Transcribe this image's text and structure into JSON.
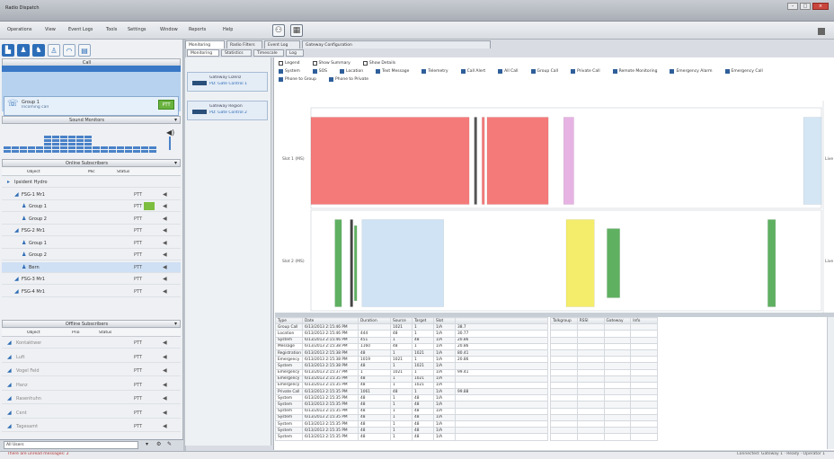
{
  "app": {
    "title": "Radio Dispatch"
  },
  "menu": {
    "items": [
      "Operations",
      "View",
      "Event Logs",
      "Tools",
      "Settings",
      "Window",
      "Reports",
      "Help"
    ]
  },
  "left": {
    "call_section": "Call",
    "call": {
      "title": "Group 1",
      "subtitle": "Incoming call",
      "ptt": "PTT"
    },
    "sound_section": "Sound Monitors",
    "meter_levels": [
      0.3,
      0.3,
      0.3,
      0.3,
      0.3,
      0.65,
      0.65,
      0.65,
      0.65,
      0.65,
      0.65,
      0.3,
      0.3,
      0.3,
      0.3,
      0.3,
      0.22,
      0.22,
      0.22
    ],
    "online_section": "Online Subscribers",
    "online_headers": [
      "Object",
      "Mic",
      "Status"
    ],
    "tree": [
      {
        "label": "Ipsident Hydro",
        "indent": 0,
        "ptt": "",
        "sel": false,
        "green": false
      },
      {
        "label": "FSG-1 Mr1",
        "indent": 1,
        "ptt": "PTT",
        "sel": false,
        "green": false
      },
      {
        "label": "Group 1",
        "indent": 2,
        "ptt": "PTT",
        "sel": false,
        "green": true
      },
      {
        "label": "Group 2",
        "indent": 2,
        "ptt": "PTT",
        "sel": false,
        "green": false
      },
      {
        "label": "FSG-2 Mr1",
        "indent": 1,
        "ptt": "PTT",
        "sel": false,
        "green": false
      },
      {
        "label": "Group 1",
        "indent": 2,
        "ptt": "PTT",
        "sel": false,
        "green": false
      },
      {
        "label": "Group 2",
        "indent": 2,
        "ptt": "PTT",
        "sel": false,
        "green": false
      },
      {
        "label": "Bern",
        "indent": 2,
        "ptt": "PTT",
        "sel": true,
        "green": false
      },
      {
        "label": "FSG-3 Mr1",
        "indent": 1,
        "ptt": "PTT",
        "sel": false,
        "green": false
      },
      {
        "label": "FSG-4 Mr1",
        "indent": 1,
        "ptt": "PTT",
        "sel": false,
        "green": false
      }
    ],
    "offline_section": "Offline Subscribers",
    "offline_headers": [
      "Object",
      "Prio",
      "Status"
    ],
    "offline": [
      {
        "label": "Kontaktwer",
        "ptt": "PTT"
      },
      {
        "label": "Luft",
        "ptt": "PTT"
      },
      {
        "label": "Vogel Feld",
        "ptt": "PTT"
      },
      {
        "label": "Hanz",
        "ptt": "PTT"
      },
      {
        "label": "Rasenhuhn",
        "ptt": "PTT"
      },
      {
        "label": "Cent",
        "ptt": "PTT"
      },
      {
        "label": "Tagesamt",
        "ptt": "PTT"
      }
    ],
    "bottom_select": "All Users"
  },
  "tabs": {
    "main": [
      "Monitoring",
      "Radio Filters",
      "Event Log",
      "Gateway Configuration"
    ],
    "sub": [
      "Monitoring",
      "Statistics",
      "Timescale",
      "Log"
    ]
  },
  "gateways": [
    {
      "name": "Gateway Lizenz",
      "status": "PD: Gate Control 1"
    },
    {
      "name": "Gateway Region",
      "status": "PD: Gate Control 2"
    }
  ],
  "legend": {
    "row1": [
      {
        "label": "Legend",
        "on": false
      },
      {
        "label": "Show Summary",
        "on": false
      },
      {
        "label": "Show Details",
        "on": false
      }
    ],
    "row2": [
      {
        "label": "System",
        "on": true
      },
      {
        "label": "SOS",
        "on": true
      },
      {
        "label": "Location",
        "on": true
      },
      {
        "label": "Text Message",
        "on": true
      },
      {
        "label": "Telemetry",
        "on": true
      },
      {
        "label": "Call Alert",
        "on": true
      },
      {
        "label": "All Call",
        "on": true
      },
      {
        "label": "Group Call",
        "on": true
      },
      {
        "label": "Private Call",
        "on": true
      },
      {
        "label": "Remote Monitoring",
        "on": true
      },
      {
        "label": "Emergency Alarm",
        "on": true
      },
      {
        "label": "Emergency Call",
        "on": true
      }
    ],
    "row3": [
      {
        "label": "Phone to Group",
        "on": true
      },
      {
        "label": "Phone to Private",
        "on": true
      }
    ]
  },
  "chart_data": {
    "type": "timeline",
    "rows": [
      "Slot 1 (MS)",
      "Slot 2 (MS)"
    ],
    "right_label": "Live",
    "bars": [
      {
        "row": 0,
        "start": 0.0,
        "end": 0.31,
        "color": "#f47a7a",
        "h": 0.92
      },
      {
        "row": 0,
        "start": 0.32,
        "end": 0.325,
        "color": "#555555",
        "h": 0.92
      },
      {
        "row": 0,
        "start": 0.335,
        "end": 0.34,
        "color": "#f47a7a",
        "h": 0.92
      },
      {
        "row": 0,
        "start": 0.345,
        "end": 0.465,
        "color": "#f47a7a",
        "h": 0.92
      },
      {
        "row": 0,
        "start": 0.495,
        "end": 0.515,
        "color": "#e6b3e3",
        "h": 0.92
      },
      {
        "row": 0,
        "start": 0.965,
        "end": 1.0,
        "color": "#d4e6f4",
        "h": 0.92
      },
      {
        "row": 1,
        "start": 0.047,
        "end": 0.06,
        "color": "#5fb061",
        "h": 0.92
      },
      {
        "row": 1,
        "start": 0.077,
        "end": 0.082,
        "color": "#444444",
        "h": 0.92
      },
      {
        "row": 1,
        "start": 0.085,
        "end": 0.09,
        "color": "#5fb061",
        "h": 0.8
      },
      {
        "row": 1,
        "start": 0.1,
        "end": 0.26,
        "color": "#cfe3f5",
        "h": 0.92
      },
      {
        "row": 1,
        "start": 0.5,
        "end": 0.555,
        "color": "#f4ec6b",
        "h": 0.92
      },
      {
        "row": 1,
        "start": 0.58,
        "end": 0.605,
        "color": "#5fb061",
        "h": 0.74
      },
      {
        "row": 1,
        "start": 0.895,
        "end": 0.91,
        "color": "#5fb061",
        "h": 0.92
      }
    ]
  },
  "table": {
    "left_headers": [
      "Type",
      "Date",
      "Duration",
      "Source",
      "Target",
      "Slot"
    ],
    "right_headers": [
      "Talkgroup",
      "RSSI",
      "Gateway",
      "Info"
    ],
    "rows": [
      [
        "Group Call",
        "6/13/2013 2:15:46 PM",
        "",
        "1021",
        "1",
        "1/A",
        "38.7"
      ],
      [
        "Location",
        "6/13/2013 2:15:46 PM",
        "444",
        "48",
        "1",
        "1/A",
        "30.77"
      ],
      [
        "System",
        "6/13/2013 2:15:46 PM",
        "451",
        "1",
        "48",
        "1/A",
        "20.86"
      ],
      [
        "Message",
        "6/13/2013 2:15:38 PM",
        "1160",
        "48",
        "1",
        "1/A",
        "20.86"
      ],
      [
        "Registration",
        "6/13/2013 2:15:38 PM",
        "48",
        "1",
        "1021",
        "1/A",
        "80.41"
      ],
      [
        "Emergency",
        "6/13/2013 2:15:38 PM",
        "1019",
        "1021",
        "1",
        "1/A",
        "20.86"
      ],
      [
        "System",
        "6/13/2013 2:15:38 PM",
        "48",
        "1",
        "1021",
        "1/A",
        ""
      ],
      [
        "Emergency",
        "6/13/2013 2:15:37 PM",
        "1",
        "1021",
        "1",
        "1/A",
        "99.41"
      ],
      [
        "Emergency",
        "6/13/2013 2:15:35 PM",
        "48",
        "1",
        "1021",
        "1/A",
        ""
      ],
      [
        "Emergency",
        "6/13/2013 2:15:35 PM",
        "48",
        "1",
        "1021",
        "1/A",
        ""
      ],
      [
        "Private Call",
        "6/13/2013 2:15:35 PM",
        "1061",
        "48",
        "1",
        "1/A",
        "99.88"
      ],
      [
        "System",
        "6/13/2013 2:15:35 PM",
        "48",
        "1",
        "48",
        "1/A",
        ""
      ],
      [
        "System",
        "6/13/2013 2:15:35 PM",
        "48",
        "1",
        "48",
        "1/A",
        ""
      ],
      [
        "System",
        "6/13/2013 2:15:35 PM",
        "48",
        "1",
        "48",
        "1/A",
        ""
      ],
      [
        "System",
        "6/13/2013 2:15:35 PM",
        "48",
        "1",
        "48",
        "1/A",
        ""
      ],
      [
        "System",
        "6/13/2013 2:15:35 PM",
        "48",
        "1",
        "48",
        "1/A",
        ""
      ],
      [
        "System",
        "6/13/2013 2:15:35 PM",
        "48",
        "1",
        "48",
        "1/A",
        ""
      ],
      [
        "System",
        "6/13/2013 2:15:35 PM",
        "48",
        "1",
        "48",
        "1/A",
        ""
      ]
    ]
  },
  "status": {
    "left": "There are unread messages: 2",
    "right": "Connected: Gateway 1 · Ready · Operator 1"
  }
}
